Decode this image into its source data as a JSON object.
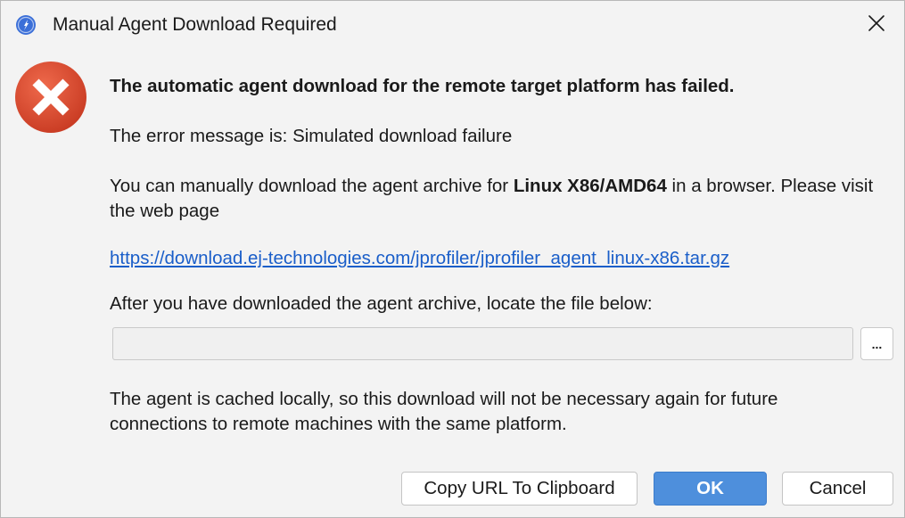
{
  "window": {
    "title": "Manual Agent Download Required"
  },
  "message": {
    "headline": "The automatic agent download for the remote target platform has failed.",
    "error_line": "The error message is: Simulated download failure",
    "manual_prefix": "You can manually download the agent archive for ",
    "platform": "Linux X86/AMD64",
    "manual_suffix": " in a browser. Please visit the web page",
    "url": "https://download.ej-technologies.com/jprofiler/jprofiler_agent_linux-x86.tar.gz",
    "locate_line": "After you have downloaded the agent archive, locate the file below:",
    "cache_line": "The agent is cached locally, so this download will not be necessary again for future connections to remote machines with the same platform."
  },
  "file_field": {
    "value": "",
    "browse_label": "..."
  },
  "buttons": {
    "copy_url": "Copy URL To Clipboard",
    "ok": "OK",
    "cancel": "Cancel"
  },
  "icons": {
    "app": "jprofiler-app-icon",
    "close": "close-icon",
    "error": "error-icon"
  },
  "colors": {
    "accent": "#4e8fdc",
    "link": "#1a5ec9",
    "error_red": "#d9452b"
  }
}
